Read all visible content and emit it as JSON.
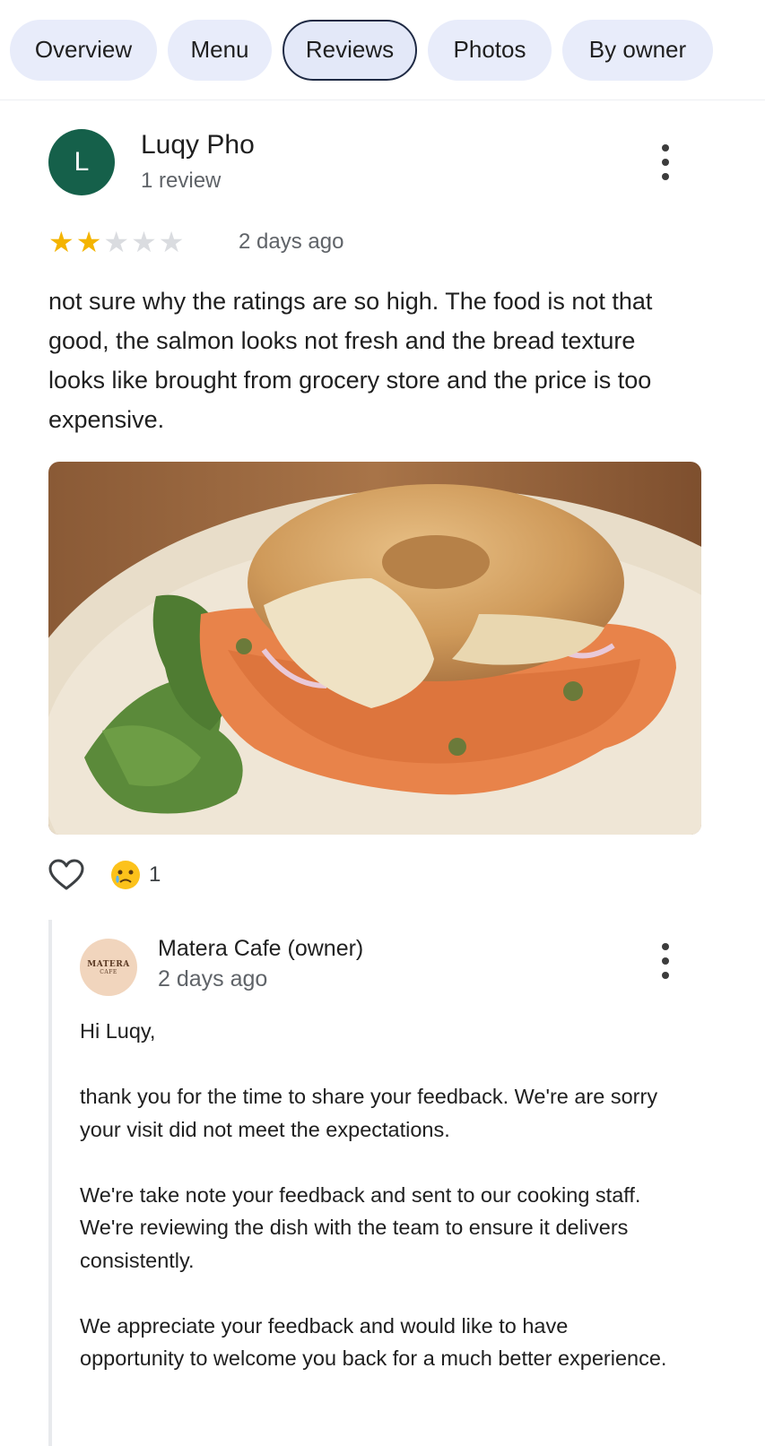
{
  "tabs": [
    {
      "label": "Overview",
      "active": false
    },
    {
      "label": "Menu",
      "active": false
    },
    {
      "label": "Reviews",
      "active": true
    },
    {
      "label": "Photos",
      "active": false
    },
    {
      "label": "By owner",
      "active": false
    }
  ],
  "review": {
    "avatar_letter": "L",
    "avatar_color": "#15604a",
    "name": "Luqy Pho",
    "meta": "1 review",
    "rating": 2,
    "rating_max": 5,
    "date": "2 days ago",
    "text": "not sure why the ratings are so high. The food is not that good, the salmon looks not fresh and the bread texture looks like brought from grocery store and the price is too expensive.",
    "photo_icon": "salmon-bagel-photo",
    "like_icon": "heart-outline-icon",
    "reaction_icon": "crying-face-emoji",
    "reaction_count": "1"
  },
  "owner_reply": {
    "logo_line1": "MATERA",
    "logo_line2": "CAFE",
    "name": "Matera Cafe (owner)",
    "date": "2 days ago",
    "paragraphs": [
      "Hi Luqy,",
      "thank you for the time to share your feedback. We're are sorry your visit did not meet the expectations.",
      "We're take note your feedback and sent to our cooking staff. We're reviewing the dish with the team to ensure it delivers consistently.",
      "We appreciate your feedback and would like to have opportunity to welcome you back for a much better experience."
    ]
  },
  "colors": {
    "tab_bg": "#e8ecfa",
    "star_filled": "#f4b400",
    "star_empty": "#dadce0"
  }
}
